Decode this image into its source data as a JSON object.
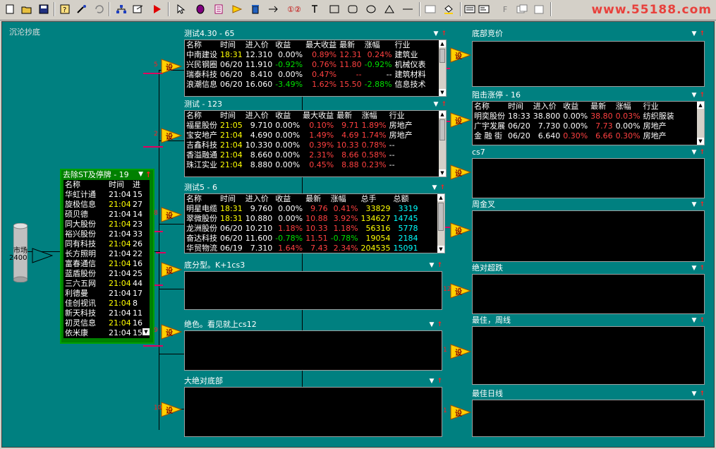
{
  "toolbar": {
    "icons": [
      "new-icon",
      "open-icon",
      "save-icon",
      "sep",
      "help-icon",
      "tool-icon",
      "undo-icon",
      "sep",
      "tree-icon",
      "export-icon",
      "run-icon",
      "sep",
      "pointer-icon",
      "stock-node-icon",
      "list-node-icon",
      "filter-node-icon",
      "delete-icon",
      "arrow-tool-icon",
      "circle-tool-icon",
      "text-tool-icon",
      "rect-tool-icon",
      "roundrect-tool-icon",
      "ellipse-tool-icon",
      "triangle-tool-icon",
      "line-tool-icon",
      "sep",
      "window-icon",
      "fill-icon",
      "sep",
      "list-tool-icon",
      "form-tool-icon",
      "f-tool-icon",
      "copy-tool-icon",
      "paste-tool-icon"
    ],
    "text_items": {
      "f": "F",
      "circle_12": "①②"
    }
  },
  "watermark": "www.55188.com",
  "canvas_title": "沉沦抄底",
  "source": {
    "label": "市场",
    "value": "2400"
  },
  "st_panel": {
    "title": "去除ST及停牌 - 19",
    "headers": [
      "名称",
      "时间",
      "进"
    ],
    "rows": [
      [
        "华虹计通",
        "21:04",
        "15"
      ],
      [
        "旋极信息",
        "21:04",
        "27"
      ],
      [
        "硕贝德",
        "21:04",
        "14"
      ],
      [
        "同大股份",
        "21:04",
        "23"
      ],
      [
        "裕兴股份",
        "21:04",
        "33"
      ],
      [
        "同有科技",
        "21:04",
        "26"
      ],
      [
        "长方照明",
        "21:04",
        "22"
      ],
      [
        "富春通信",
        "21:04",
        "16"
      ],
      [
        "蓝盾股份",
        "21:04",
        "25"
      ],
      [
        "三六五网",
        "21:04",
        "44"
      ],
      [
        "利德曼",
        "21:04",
        "17"
      ],
      [
        "佳创视讯",
        "21:04",
        "8"
      ],
      [
        "新天科技",
        "21:04",
        "11"
      ],
      [
        "初灵信息",
        "21:04",
        "16"
      ],
      [
        "依米康",
        "21:04",
        "15"
      ]
    ]
  },
  "panel_test430": {
    "title": "测试4.30 - 65",
    "headers": [
      "名称",
      "时间",
      "进入价",
      "收益",
      "最大收益",
      "最新",
      "涨幅",
      "行业"
    ],
    "rows": [
      [
        "中南建设",
        "18:31",
        "12.310",
        "0.00%",
        "0.89%",
        "12.31",
        "0.24%",
        "建筑业"
      ],
      [
        "兴民钢圈",
        "06/20",
        "11.910",
        "-0.92%",
        "0.76%",
        "11.80",
        "-0.92%",
        "机械仪表"
      ],
      [
        "瑞泰科技",
        "06/20",
        "8.410",
        "0.00%",
        "0.47%",
        "--",
        "--",
        "建筑材料"
      ],
      [
        "浪潮信息",
        "06/20",
        "16.060",
        "-3.49%",
        "1.62%",
        "15.50",
        "-2.88%",
        "信息技术"
      ]
    ]
  },
  "panel_test123": {
    "title": "测试 - 123",
    "headers": [
      "名称",
      "时间",
      "进入价",
      "收益",
      "最大收益",
      "最新",
      "涨幅",
      "行业"
    ],
    "rows": [
      [
        "福星股份",
        "21:05",
        "9.710",
        "0.00%",
        "0.10%",
        "9.71",
        "1.89%",
        "房地产"
      ],
      [
        "宝安地产",
        "21:04",
        "4.690",
        "0.00%",
        "1.49%",
        "4.69",
        "1.74%",
        "房地产"
      ],
      [
        "吉鑫科技",
        "21:04",
        "10.330",
        "0.00%",
        "0.39%",
        "10.33",
        "0.78%",
        "--"
      ],
      [
        "香溢融通",
        "21:04",
        "8.660",
        "0.00%",
        "2.31%",
        "8.66",
        "0.58%",
        "--"
      ],
      [
        "珠江实业",
        "21:04",
        "8.880",
        "0.00%",
        "0.45%",
        "8.88",
        "0.23%",
        "--"
      ]
    ]
  },
  "panel_test5": {
    "title": "测试5 - 6",
    "headers": [
      "名称",
      "时间",
      "进入价",
      "收益",
      "最新",
      "涨幅",
      "总手",
      "总额"
    ],
    "rows": [
      [
        "明星电缆",
        "18:31",
        "9.760",
        "0.00%",
        "9.76",
        "0.41%",
        "33829",
        "3319"
      ],
      [
        "翠微股份",
        "18:31",
        "10.880",
        "0.00%",
        "10.88",
        "3.92%",
        "134627",
        "14745"
      ],
      [
        "龙洲股份",
        "06/20",
        "10.210",
        "1.18%",
        "10.33",
        "1.18%",
        "56316",
        "5778"
      ],
      [
        "奋达科技",
        "06/20",
        "11.600",
        "-0.78%",
        "11.51",
        "-0.78%",
        "19054",
        "2184"
      ],
      [
        "华贸物流",
        "06/19",
        "7.310",
        "1.64%",
        "7.43",
        "2.34%",
        "204535",
        "15091"
      ]
    ]
  },
  "panel_bottom_type": {
    "title": "底分型。K+1cs3"
  },
  "panel_jue_se": {
    "title": "绝色。看见就上cs12"
  },
  "panel_da_jue_dui": {
    "title": "大绝对底部"
  },
  "panel_di_bu_jing_jia": {
    "title": "底部竞价"
  },
  "panel_zu_ji": {
    "title": "阻击涨停 - 16",
    "headers": [
      "名称",
      "时间",
      "进入价",
      "收益",
      "最新",
      "涨幅",
      "行业"
    ],
    "rows": [
      [
        "明奕股份",
        "18:33",
        "38.800",
        "0.00%",
        "38.80",
        "0.03%",
        "纺织服装"
      ],
      [
        "广宇发展",
        "06/20",
        "7.730",
        "0.00%",
        "7.73",
        "0.00%",
        "房地产"
      ],
      [
        "金 融 街",
        "06/20",
        "6.640",
        "0.30%",
        "6.66",
        "0.30%",
        "房地产"
      ]
    ]
  },
  "panel_cs7": {
    "title": "cs7"
  },
  "panel_zhou_jin_cha": {
    "title": "周金叉"
  },
  "panel_jue_dui_chao_die": {
    "title": "绝对超跌"
  },
  "panel_zui_jia_zhou": {
    "title": "最佳，周线"
  },
  "panel_zui_jia_ri": {
    "title": "最佳日线"
  },
  "node_labels": {
    "she": "设"
  },
  "node_numbers": [
    "5",
    "2",
    "8",
    "9",
    "10",
    "13",
    "12",
    "1",
    "1"
  ],
  "colors": {
    "canvas": "#008080",
    "up": "#ff4040",
    "down": "#00e000",
    "time_hl": "#ffff00",
    "node_fill": "#ffd000"
  }
}
